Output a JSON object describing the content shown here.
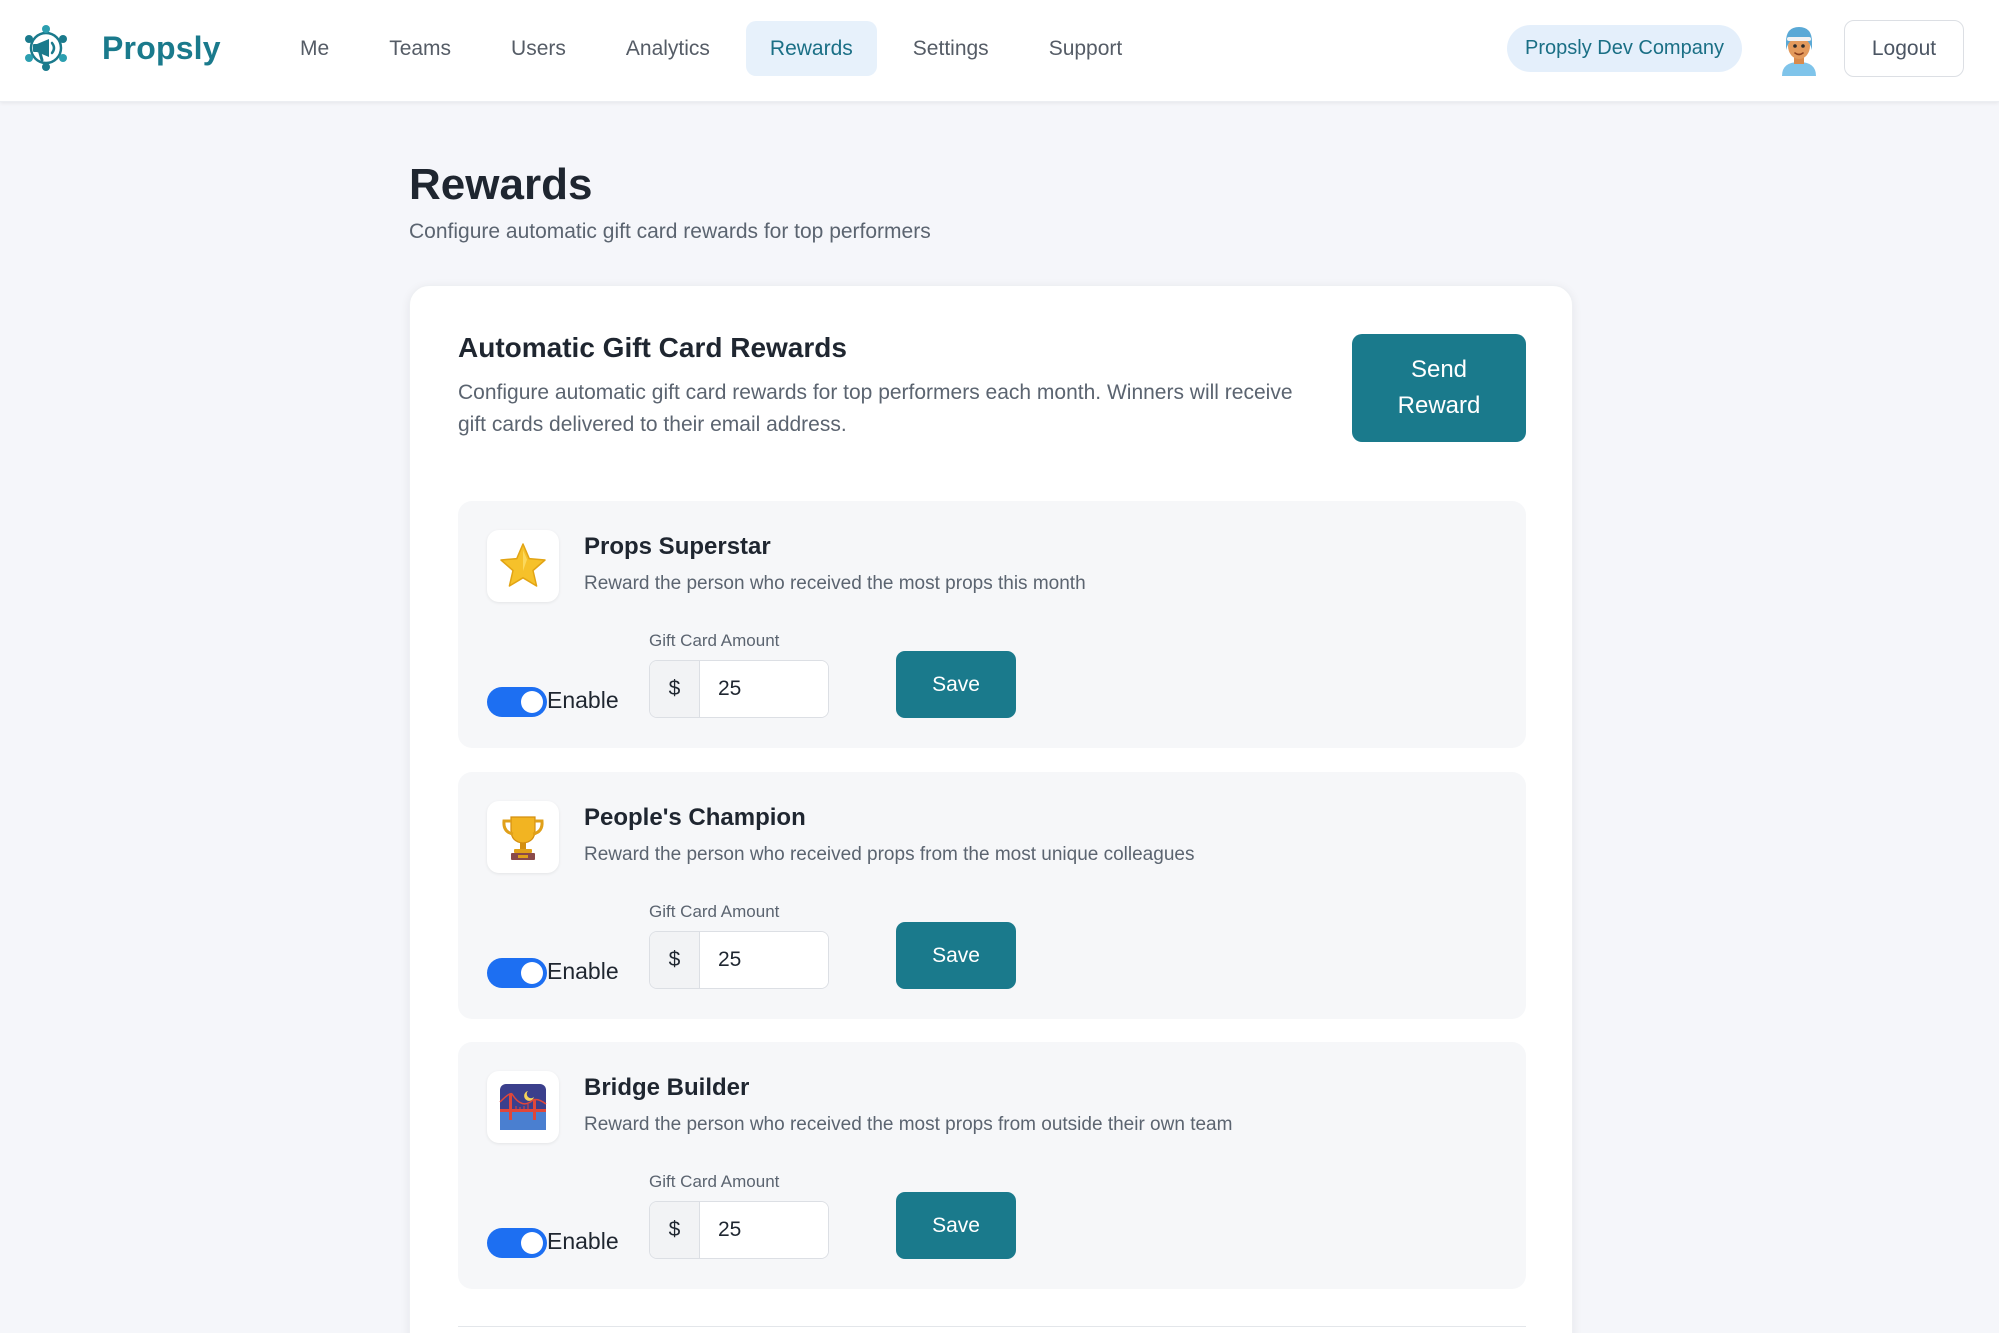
{
  "brand": {
    "name": "Propsly",
    "logo_icon": "megaphone-globe-logo"
  },
  "nav": {
    "items": [
      {
        "label": "Me",
        "active": false
      },
      {
        "label": "Teams",
        "active": false
      },
      {
        "label": "Users",
        "active": false
      },
      {
        "label": "Analytics",
        "active": false
      },
      {
        "label": "Rewards",
        "active": true
      },
      {
        "label": "Settings",
        "active": false
      },
      {
        "label": "Support",
        "active": false
      }
    ]
  },
  "header": {
    "company": "Propsly Dev Company",
    "avatar_icon": "user-avatar",
    "logout_label": "Logout"
  },
  "page": {
    "title": "Rewards",
    "subtitle": "Configure automatic gift card rewards for top performers"
  },
  "card": {
    "title": "Automatic Gift Card Rewards",
    "description": "Configure automatic gift card rewards for top performers each month. Winners will receive gift cards delivered to their email address.",
    "send_reward_label": "Send Reward"
  },
  "rewards": [
    {
      "title": "Props Superstar",
      "description": "Reward the person who received the most props this month",
      "icon": "star-icon",
      "enabled": true,
      "toggle_label": "Enable",
      "amount_label": "Gift Card Amount",
      "currency": "$",
      "amount": "25",
      "save_label": "Save"
    },
    {
      "title": "People's Champion",
      "description": "Reward the person who received props from the most unique colleagues",
      "icon": "trophy-icon",
      "enabled": true,
      "toggle_label": "Enable",
      "amount_label": "Gift Card Amount",
      "currency": "$",
      "amount": "25",
      "save_label": "Save"
    },
    {
      "title": "Bridge Builder",
      "description": "Reward the person who received the most props from outside their own team",
      "icon": "bridge-at-night-icon",
      "enabled": true,
      "toggle_label": "Enable",
      "amount_label": "Gift Card Amount",
      "currency": "$",
      "amount": "25",
      "save_label": "Save"
    }
  ],
  "colors": {
    "brand": "#1a7a8c",
    "nav_active_bg": "#e7f1fb",
    "toggle_on": "#1d6ff2",
    "page_bg": "#f5f6fa"
  }
}
